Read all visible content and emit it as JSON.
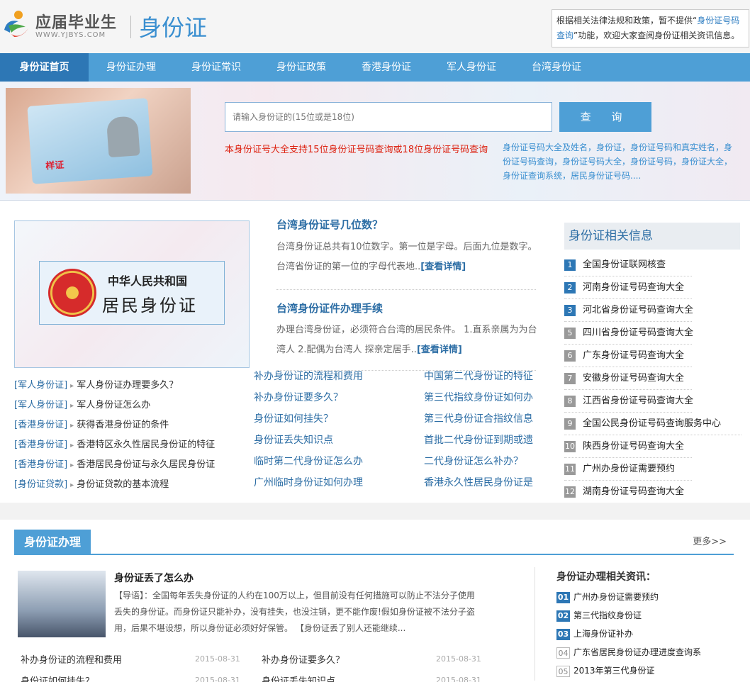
{
  "header": {
    "logo_cn": "应届毕业生",
    "logo_url": "WWW.YJBYS.COM",
    "site_title": "身份证",
    "notice_pre": "根据相关法律法规和政策，暂不提供“",
    "notice_link": "身份证号码查询",
    "notice_post": "”功能，欢迎大家查阅身份证相关资讯信息。"
  },
  "nav": [
    "身份证首页",
    "身份证办理",
    "身份证常识",
    "身份证政策",
    "香港身份证",
    "军人身份证",
    "台湾身份证"
  ],
  "banner": {
    "placeholder": "请输入身份证的(15位或是18位)",
    "button": "查 询",
    "red_text": "本身份证号大全支持15位身份证号码查询或18位身份证号码查询",
    "links": "身份证号码大全及姓名，身份证，身份证号码和真实姓名，身份证号码查询，身份证号码大全，身份证号码，身份证大全，身份证查询系统，居民身份证号码....",
    "stamp": "样证"
  },
  "featured": {
    "line1": "中华人民共和国",
    "line2": "居民身份证"
  },
  "articles": [
    {
      "title": "台湾身份证号几位数？",
      "body": "台湾身份证总共有10位数字。第一位是字母。后面九位是数字。 台湾省份证的第一位的字母代表地..",
      "more": "[查看详情]"
    },
    {
      "title": "台湾身份证件办理手续",
      "body": "办理台湾身份证，必须符合台湾的居民条件。 1.直系亲属为为台湾人 2.配偶为台湾人 探亲定居手..",
      "more": "[查看详情]"
    }
  ],
  "left_list": [
    {
      "tag": "[军人身份证]",
      "text": "军人身份证办理要多久？"
    },
    {
      "tag": "[军人身份证]",
      "text": "军人身份证怎么办"
    },
    {
      "tag": "[香港身份证]",
      "text": "获得香港身份证的条件"
    },
    {
      "tag": "[香港身份证]",
      "text": "香港特区永久性居民身份证的特征"
    },
    {
      "tag": "[香港身份证]",
      "text": "香港居民身份证与永久居民身份证"
    },
    {
      "tag": "[身份证贷款]",
      "text": "身份证贷款的基本流程"
    }
  ],
  "mid_list": [
    "补办身份证的流程和费用",
    "补办身份证要多久？",
    "身份证如何挂失？",
    "身份证丢失知识点",
    "临时第二代身份证怎么办",
    "广州临时身份证如何办理"
  ],
  "right_list": [
    "中国第二代身份证的特征",
    "第三代指纹身份证如何办",
    "第三代身份证合指纹信息",
    "首批二代身份证到期或遗",
    "二代身份证怎么补办？",
    "香港永久性居民身份证是"
  ],
  "side": {
    "title": "身份证相关信息",
    "items": [
      "全国身份证联网核查",
      "河南身份证号码查询大全",
      "河北省身份证号码查询大全",
      "四川省身份证号码查询大全",
      "广东身份证号码查询大全",
      "安徽身份证号码查询大全",
      "江西省身份证号码查询大全",
      "全国公民身份证号码查询服务中心",
      "陕西身份证号码查询大全",
      "广州办身份证需要预约",
      "湖南身份证号码查询大全"
    ],
    "nums": [
      "1",
      "2",
      "3",
      "4",
      "5",
      "6",
      "7",
      "8",
      "9",
      "10",
      "11",
      "12"
    ]
  },
  "section": {
    "title": "身份证办理",
    "more": "更多>>",
    "art_title": "身份证丢了怎么办",
    "art_body": "【导语】：全国每年丢失身份证的人约在100万以上，但目前没有任何措施可以防止不法分子使用丢失的身份证。而身份证只能补办，没有挂失，也没注销，更不能作废!假如身份证被不法分子盗用，后果不堪设想，所以身份证必须好好保管。 【身份证丢了别人还能继续...",
    "rows": [
      {
        "l": "补办身份证的流程和费用",
        "ld": "2015-08-31",
        "r": "补办身份证要多久？",
        "rd": "2015-08-31"
      },
      {
        "l": "身份证如何挂失？",
        "ld": "2015-08-31",
        "r": "身份证丢失知识点",
        "rd": "2015-08-31"
      }
    ],
    "rel_title": "身份证办理相关资讯：",
    "rel": [
      {
        "n": "01",
        "t": "广州办身份证需要预约"
      },
      {
        "n": "02",
        "t": "第三代指纹身份证"
      },
      {
        "n": "03",
        "t": "上海身份证补办"
      },
      {
        "n": "04",
        "t": "广东省居民身份证办理进度查询系"
      },
      {
        "n": "05",
        "t": "2013年第三代身份证"
      }
    ]
  },
  "colors": {
    "nav_bg": "#4e9fd6",
    "nav_active": "#2d77b5",
    "link": "#2d6ea5",
    "red": "#dd2211"
  }
}
